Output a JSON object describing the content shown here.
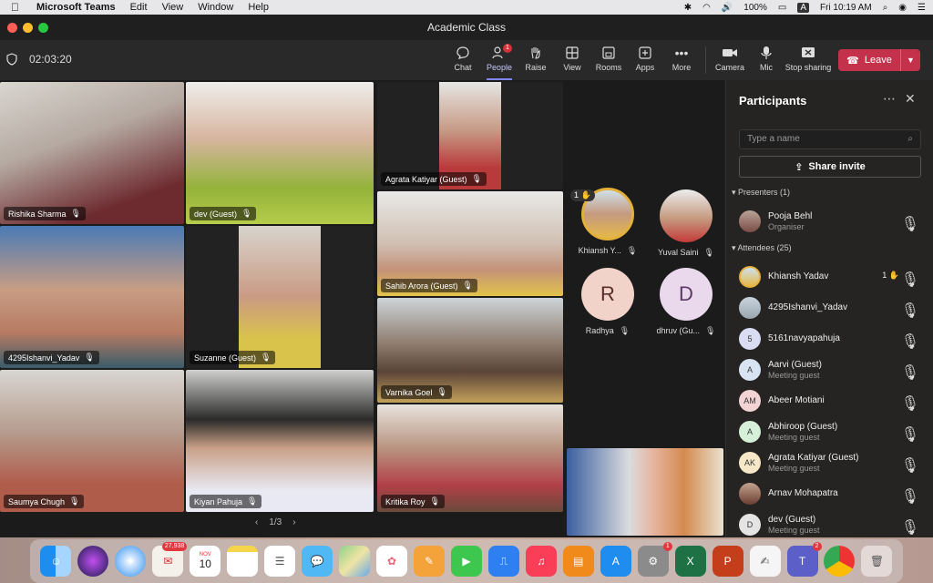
{
  "menubar": {
    "app_name": "Microsoft Teams",
    "menus": [
      "Edit",
      "View",
      "Window",
      "Help"
    ],
    "battery": "100%",
    "input_indicator": "A",
    "clock": "Fri 10:19 AM"
  },
  "window": {
    "title": "Academic Class"
  },
  "toolbar": {
    "timer": "02:03:20",
    "people_badge": "1",
    "tools": [
      "Chat",
      "People",
      "Raise",
      "View",
      "Rooms",
      "Apps",
      "More"
    ],
    "devices": [
      "Camera",
      "Mic",
      "Stop sharing"
    ],
    "leave_label": "Leave"
  },
  "grid": {
    "tiles": [
      {
        "name": "Rishika Sharma"
      },
      {
        "name": "dev (Guest)"
      },
      {
        "name": "Agrata Katiyar (Guest)"
      },
      {
        "name": "4295Ishanvi_Yadav"
      },
      {
        "name": "Suzanne (Guest)"
      },
      {
        "name": "Sahib Arora (Guest)"
      },
      {
        "name": "Varnika Goel"
      },
      {
        "name": "Saumya Chugh"
      },
      {
        "name": "Kiyan Pahuja"
      },
      {
        "name": "Kritika Roy"
      }
    ],
    "avatars": [
      {
        "name": "Khiansh Y...",
        "hand": "1"
      },
      {
        "name": "Yuval Saini"
      },
      {
        "name": "Radhya",
        "initial": "R"
      },
      {
        "name": "dhruv (Gu...",
        "initial": "D"
      }
    ],
    "pager": "1/3"
  },
  "panel": {
    "title": "Participants",
    "search_placeholder": "Type a name",
    "invite_label": "Share invite",
    "presenters_label": "Presenters (1)",
    "attendees_label": "Attendees (25)",
    "presenters": [
      {
        "name": "Pooja Behl",
        "role": "Organiser"
      }
    ],
    "attendees": [
      {
        "name": "Khiansh Yadav",
        "hand": "1"
      },
      {
        "name": "4295Ishanvi_Yadav"
      },
      {
        "name": "5161navyapahuja",
        "initial": "5"
      },
      {
        "name": "Aarvi (Guest)",
        "role": "Meeting guest",
        "initial": "A"
      },
      {
        "name": "Abeer Motiani",
        "initial": "AM"
      },
      {
        "name": "Abhiroop (Guest)",
        "role": "Meeting guest",
        "initial": "A"
      },
      {
        "name": "Agrata Katiyar (Guest)",
        "role": "Meeting guest",
        "initial": "AK"
      },
      {
        "name": "Arnav Mohapatra"
      },
      {
        "name": "dev (Guest)",
        "role": "Meeting guest",
        "initial": "D"
      }
    ]
  },
  "dock": {
    "calendar_month": "NOV",
    "calendar_day": "10",
    "photos_badge": "27,938",
    "settings_badge": "1",
    "teams_badge": "2"
  }
}
